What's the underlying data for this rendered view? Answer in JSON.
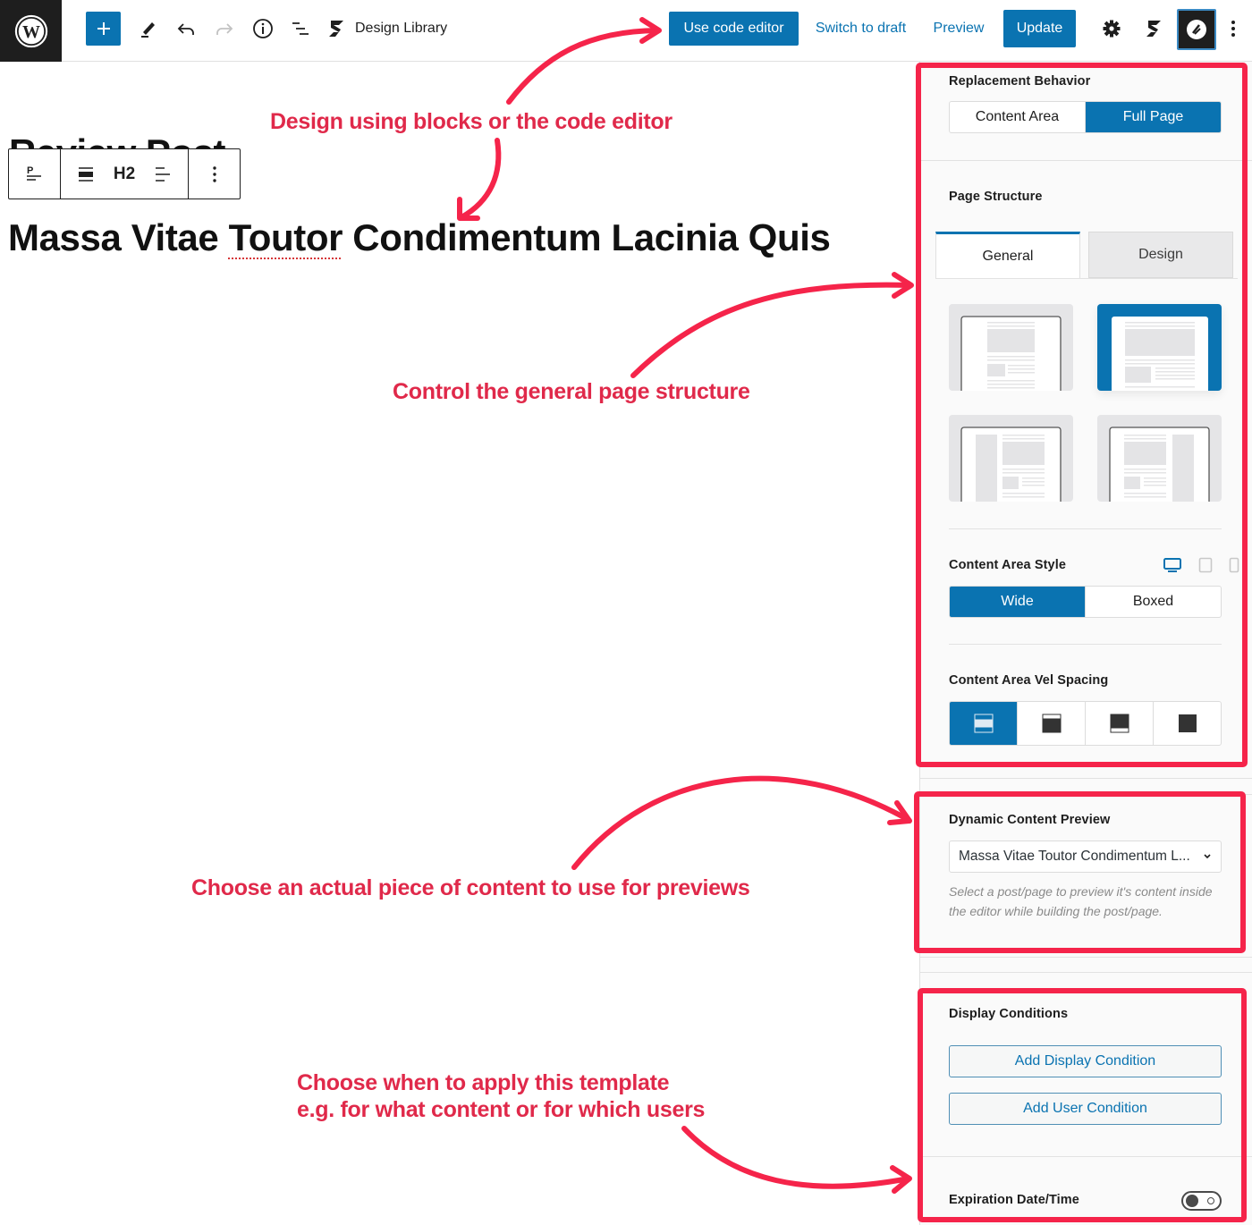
{
  "topbar": {
    "design_library_label": "Design Library",
    "use_code_editor_label": "Use code editor",
    "switch_to_draft_label": "Switch to draft",
    "preview_label": "Preview",
    "update_label": "Update",
    "icons": [
      "wordpress-logo",
      "plus",
      "pencil-tools",
      "undo",
      "redo",
      "info",
      "list-view",
      "stackable-logo",
      "gear",
      "stackable-logo",
      "plugin-logo",
      "more-vertical"
    ]
  },
  "editor": {
    "post_title_partial": "Review Post",
    "block_toolbar": {
      "transform_icon": "paragraph-to-heading",
      "align_icon": "align-wide",
      "heading_level": "H2",
      "text_align_icon": "align-left",
      "more_icon": "more-vertical"
    },
    "heading_text_before": "Massa Vitae ",
    "heading_misspelled": "Toutor",
    "heading_text_after": " Condimentum Lacinia Quis"
  },
  "annotations": [
    {
      "text": "Design using blocks or the code editor"
    },
    {
      "text": "Control the general page structure"
    },
    {
      "text": "Choose an actual piece of content to use for previews"
    },
    {
      "text_line1": "Choose when to apply this template",
      "text_line2": "e.g. for what content or for which users"
    }
  ],
  "sidebar": {
    "replacement_behavior": {
      "label": "Replacement Behavior",
      "options": [
        "Content Area",
        "Full Page"
      ],
      "selected": "Full Page"
    },
    "page_structure": {
      "label": "Page Structure",
      "tabs": [
        "General",
        "Design"
      ],
      "active_tab": "General",
      "layouts": [
        "no-sidebar-boxed",
        "no-sidebar-full",
        "left-sidebar",
        "right-sidebar"
      ],
      "selected_layout": "no-sidebar-full"
    },
    "content_area_style": {
      "label": "Content Area Style",
      "devices": [
        "desktop",
        "tablet",
        "mobile"
      ],
      "active_device": "desktop",
      "options": [
        "Wide",
        "Boxed"
      ],
      "selected": "Wide"
    },
    "content_area_vertical_spacing": {
      "label": "Content Area Vel Spacing",
      "options": [
        "top-and-bottom",
        "bottom-only",
        "top-only",
        "none"
      ],
      "selected": "top-and-bottom"
    },
    "dynamic_content_preview": {
      "label": "Dynamic Content Preview",
      "selected_value": "Massa Vitae Toutor Condimentum L...",
      "help": "Select a post/page to preview it's content inside the editor while building the post/page."
    },
    "display_conditions": {
      "label": "Display Conditions",
      "add_display_condition": "Add Display Condition",
      "add_user_condition": "Add User Condition"
    },
    "expiration": {
      "label": "Expiration Date/Time",
      "enabled": false
    }
  },
  "colors": {
    "accent": "#0a73b1",
    "annotation_red": "#f5244a",
    "annotation_text": "#e0294a",
    "dark": "#1e1e1e"
  }
}
